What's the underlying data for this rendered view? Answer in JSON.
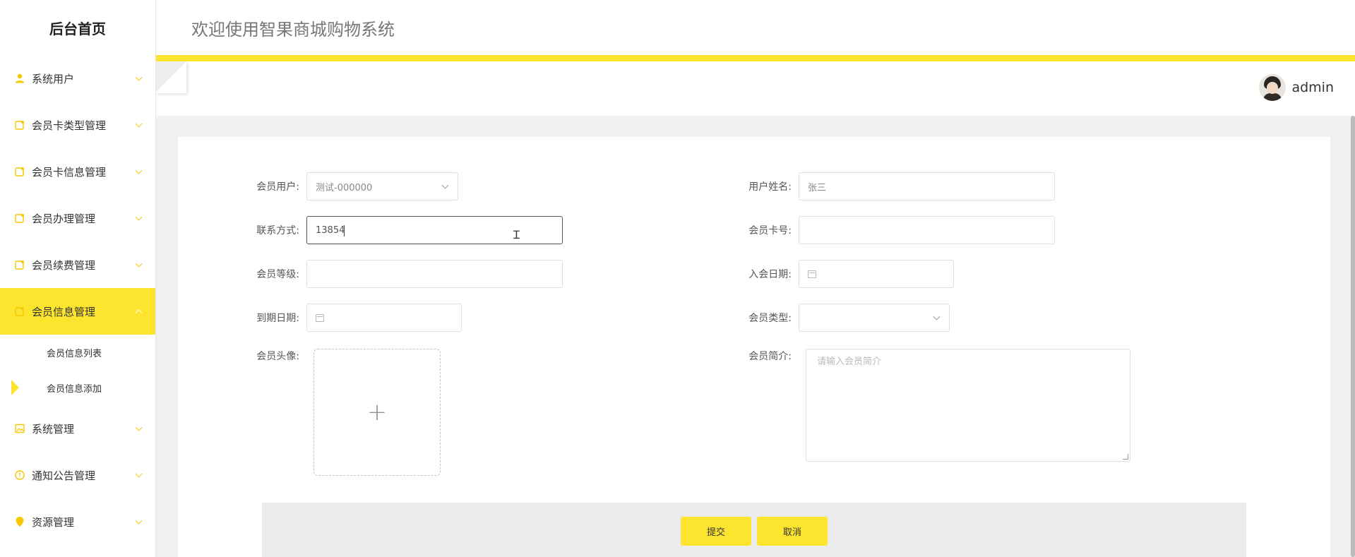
{
  "sidebar": {
    "logo": "后台首页",
    "items": [
      {
        "label": "系统用户",
        "icon": "user-icon"
      },
      {
        "label": "会员卡类型管理",
        "icon": "note-icon"
      },
      {
        "label": "会员卡信息管理",
        "icon": "note-icon"
      },
      {
        "label": "会员办理管理",
        "icon": "note-icon"
      },
      {
        "label": "会员续费管理",
        "icon": "note-icon"
      },
      {
        "label": "会员信息管理",
        "icon": "note-icon",
        "active": true
      },
      {
        "label": "系统管理",
        "icon": "image-icon"
      },
      {
        "label": "通知公告管理",
        "icon": "alert-circle-icon"
      },
      {
        "label": "资源管理",
        "icon": "location-pin-icon"
      }
    ],
    "sub_items": [
      {
        "label": "会员信息列表"
      },
      {
        "label": "会员信息添加",
        "current": true
      }
    ]
  },
  "header": {
    "title": "欢迎使用智果商城购物系统",
    "username": "admin"
  },
  "form": {
    "member_user": {
      "label": "会员用户:",
      "value": "测试-000000"
    },
    "user_name": {
      "label": "用户姓名:",
      "value": "张三"
    },
    "contact": {
      "label": "联系方式:",
      "value": "13854"
    },
    "card_no": {
      "label": "会员卡号:",
      "value": ""
    },
    "level": {
      "label": "会员等级:",
      "value": ""
    },
    "join_date": {
      "label": "入会日期:",
      "value": ""
    },
    "expire_date": {
      "label": "到期日期:",
      "value": ""
    },
    "member_type": {
      "label": "会员类型:",
      "value": ""
    },
    "avatar": {
      "label": "会员头像:"
    },
    "intro": {
      "label": "会员简介:",
      "placeholder": "请输入会员简介"
    },
    "submit_label": "提交",
    "cancel_label": "取消"
  },
  "colors": {
    "accent": "#fde52f",
    "icon": "#f5c800"
  }
}
